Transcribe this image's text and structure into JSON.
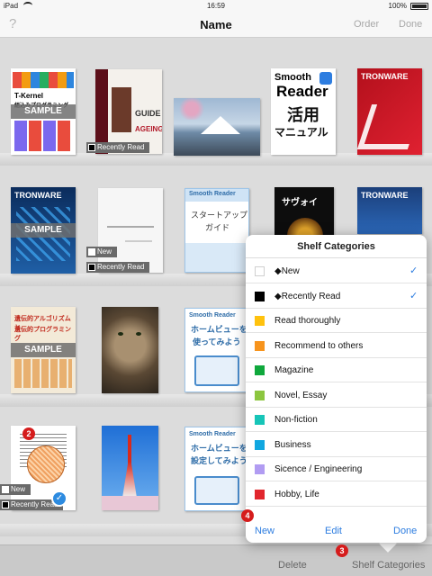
{
  "status": {
    "device": "iPad",
    "wifi": "wifi-icon",
    "time": "16:59",
    "battery": "100%"
  },
  "navbar": {
    "help": "?",
    "title": "Name",
    "order": "Order",
    "done": "Done"
  },
  "books": {
    "b1": {
      "title": "T-Kernel",
      "subtitle": "組込みプログラミング",
      "sample": "SAMPLE"
    },
    "b2": {
      "title": "GUIDE",
      "subtitle": "AGEING",
      "tag": "Recently Read"
    },
    "b4": {
      "title1": "Smooth",
      "title2": "Reader",
      "title3": "活用",
      "title4": "マニュアル"
    },
    "b5": {
      "title": "TRONWARE"
    },
    "b6": {
      "title": "TRONWARE",
      "sample": "SAMPLE"
    },
    "b7": {
      "tag1": "New",
      "tag2": "Recently Read"
    },
    "b8": {
      "title1": "Smooth Reader",
      "title2": "スタートアップ",
      "title3": "ガイド"
    },
    "b9": {
      "title": "サヴォイ"
    },
    "b10": {
      "title": "TRONWARE"
    },
    "b11": {
      "title": "遺伝的アルゴリズムと",
      "subtitle": "遺伝的プログラミング",
      "sample": "SAMPLE"
    },
    "b13": {
      "title1": "Smooth Reader",
      "title2": "ホームビューを",
      "title3": "使ってみよう"
    },
    "b14": {
      "tag1": "New",
      "tag2": "Recently Read"
    },
    "b16": {
      "title1": "Smooth Reader",
      "title2": "ホームビューを",
      "title3": "設定してみよう"
    }
  },
  "popover": {
    "title": "Shelf Categories",
    "categories": [
      {
        "label": "◆New",
        "color": "#ffffff",
        "checked": true
      },
      {
        "label": "◆Recently Read",
        "color": "#000000",
        "checked": true
      },
      {
        "label": "Read thoroughly",
        "color": "#ffc20e",
        "checked": false
      },
      {
        "label": "Recommend to others",
        "color": "#f7941d",
        "checked": false
      },
      {
        "label": "Magazine",
        "color": "#0fa83c",
        "checked": false
      },
      {
        "label": "Novel, Essay",
        "color": "#8cc63f",
        "checked": false
      },
      {
        "label": "Non-fiction",
        "color": "#17c5b8",
        "checked": false
      },
      {
        "label": "Business",
        "color": "#11a7e0",
        "checked": false
      },
      {
        "label": "Sicence / Engineering",
        "color": "#b19cf2",
        "checked": false
      },
      {
        "label": "Hobby, Life",
        "color": "#e1262d",
        "checked": false
      }
    ],
    "check_mark": "✓",
    "footer": {
      "new": "New",
      "edit": "Edit",
      "done": "Done"
    }
  },
  "bottombar": {
    "delete": "Delete",
    "categories": "Shelf Categories"
  },
  "callouts": {
    "c2": "2",
    "c3": "3",
    "c4": "4"
  }
}
